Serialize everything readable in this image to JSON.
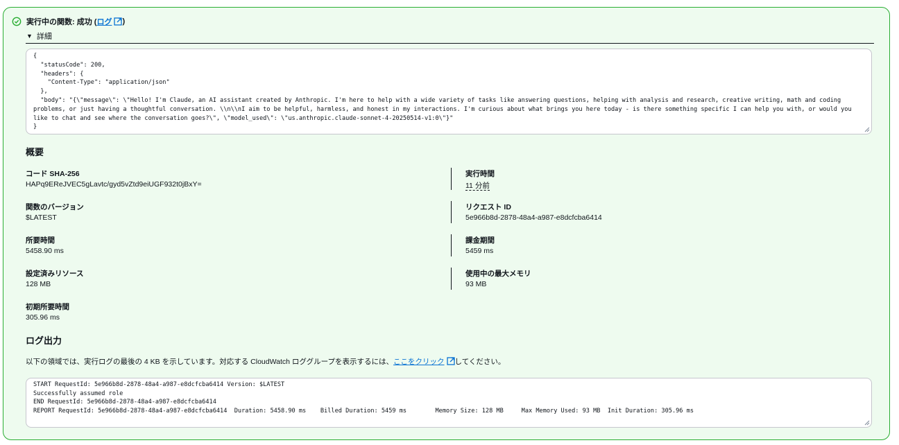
{
  "status": {
    "prefix": "実行中の関数: 成功 (",
    "link": "ログ",
    "suffix": ")"
  },
  "details": {
    "label": "詳細"
  },
  "response_json": "{\n  \"statusCode\": 200,\n  \"headers\": {\n    \"Content-Type\": \"application/json\"\n  },\n  \"body\": \"{\\\"message\\\": \\\"Hello! I'm Claude, an AI assistant created by Anthropic. I'm here to help with a wide variety of tasks like answering questions, helping with analysis and research, creative writing, math and coding problems, or just having a thoughtful conversation. \\\\n\\\\nI aim to be helpful, harmless, and honest in my interactions. I'm curious about what brings you here today - is there something specific I can help you with, or would you like to chat and see where the conversation goes?\\\", \\\"model_used\\\": \\\"us.anthropic.claude-sonnet-4-20250514-v1:0\\\"}\"\n}",
  "summary": {
    "title": "概要",
    "left": [
      {
        "label": "コード SHA-256",
        "value": "HAPq9EReJVEC5gLavtc/gyd5vZtd9eiUGF932t0jBxY="
      },
      {
        "label": "関数のバージョン",
        "value": "$LATEST"
      },
      {
        "label": "所要時間",
        "value": "5458.90 ms"
      },
      {
        "label": "設定済みリソース",
        "value": "128 MB"
      },
      {
        "label": "初期所要時間",
        "value": "305.96 ms"
      }
    ],
    "right": [
      {
        "label": "実行時間",
        "value": "11 分前"
      },
      {
        "label": "リクエスト ID",
        "value": "5e966b8d-2878-48a4-a987-e8dcfcba6414"
      },
      {
        "label": "課金期間",
        "value": "5459 ms"
      },
      {
        "label": "使用中の最大メモリ",
        "value": "93 MB"
      }
    ]
  },
  "log_output": {
    "title": "ログ出力",
    "desc_before": "以下の領域では、実行ログの最後の 4 KB を示しています。対応する CloudWatch ロググループを表示するには、",
    "link": "ここをクリック",
    "desc_after": "してください。",
    "text": "START RequestId: 5e966b8d-2878-48a4-a987-e8dcfcba6414 Version: $LATEST\nSuccessfully assumed role\nEND RequestId: 5e966b8d-2878-48a4-a987-e8dcfcba6414\nREPORT RequestId: 5e966b8d-2878-48a4-a987-e8dcfcba6414  Duration: 5458.90 ms    Billed Duration: 5459 ms        Memory Size: 128 MB     Max Memory Used: 93 MB  Init Duration: 305.96 ms"
  },
  "colors": {
    "success": "#29ad32",
    "link": "#0972d3",
    "panel_bg": "#eefbef"
  }
}
